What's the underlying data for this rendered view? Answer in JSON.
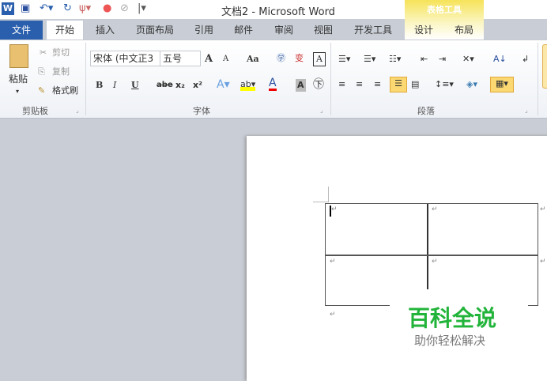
{
  "titlebar": {
    "title": "文档2 - Microsoft Word",
    "context_title": "表格工具",
    "word_icon": "W"
  },
  "tabs": {
    "file": "文件",
    "home": "开始",
    "insert": "插入",
    "layout": "页面布局",
    "references": "引用",
    "mailings": "邮件",
    "review": "审阅",
    "view": "视图",
    "developer": "开发工具",
    "design": "设计",
    "table_layout": "布局"
  },
  "clipboard": {
    "paste": "粘贴",
    "cut": "剪切",
    "copy": "复制",
    "format_painter": "格式刷",
    "group": "剪贴板"
  },
  "font": {
    "name": "宋体 (中文正3",
    "size": "五号",
    "bold": "B",
    "italic": "I",
    "underline": "U",
    "strike": "abe",
    "sub": "x₂",
    "sup": "x²",
    "change_case": "Aa",
    "grow": "A",
    "shrink": "A",
    "group": "字体"
  },
  "paragraph": {
    "group": "段落"
  },
  "watermark": {
    "title": "百科全说",
    "subtitle": "助你轻松解决"
  },
  "document": {
    "para_mark": "↵"
  }
}
